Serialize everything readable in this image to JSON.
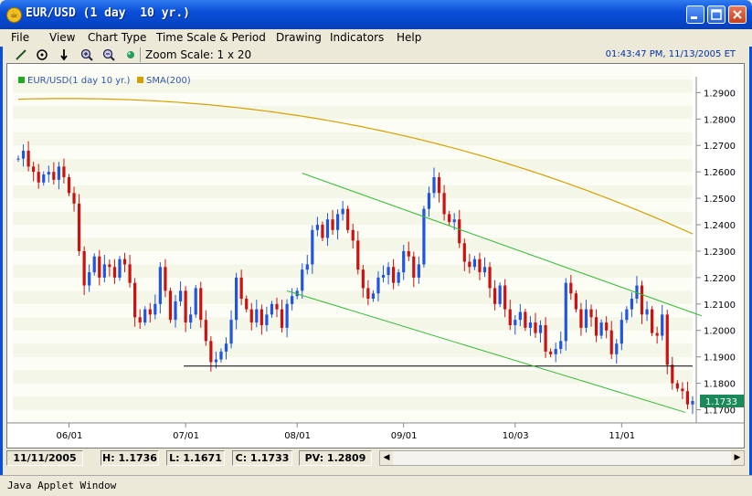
{
  "window": {
    "title": "EUR/USD (1 day  10 yr.)",
    "icon": "java-coffee-icon"
  },
  "menu": [
    "File",
    "View",
    "Chart Type",
    "Time Scale & Period",
    "Drawing",
    "Indicators",
    "Help"
  ],
  "toolbar": {
    "tools": [
      "line-draw-icon",
      "crosshair-icon",
      "arrow-down-icon",
      "zoom-in-icon",
      "zoom-out-icon",
      "color-dot-icon"
    ],
    "zoom_label": "Zoom Scale: 1 x 20",
    "datetime": "01:43:47 PM, 11/13/2005 ET"
  },
  "legend": [
    {
      "label": "EUR/USD(1 day  10 yr.)",
      "color": "#22aa22"
    },
    {
      "label": "SMA(200)",
      "color": "#d4a000"
    }
  ],
  "chart_data": {
    "type": "candlestick",
    "y_ticks": [
      "1.2900",
      "1.2800",
      "1.2700",
      "1.2600",
      "1.2500",
      "1.2400",
      "1.2300",
      "1.2200",
      "1.2100",
      "1.2000",
      "1.1900",
      "1.1800",
      "1.1700"
    ],
    "ylim": [
      1.165,
      1.296
    ],
    "x_ticks": [
      "06/01",
      "07/01",
      "08/01",
      "09/01",
      "10/03",
      "11/01"
    ],
    "last_price_label": "1.1733",
    "colors": {
      "up": "#2255dd",
      "down": "#cc1111",
      "sma": "#d4a000",
      "channel": "#33bb33",
      "support": "#000000",
      "last_price": "#1a8a5a"
    },
    "close": [
      1.265,
      1.268,
      1.262,
      1.26,
      1.256,
      1.259,
      1.26,
      1.257,
      1.262,
      1.258,
      1.252,
      1.248,
      1.23,
      1.217,
      1.222,
      1.228,
      1.22,
      1.225,
      1.224,
      1.22,
      1.227,
      1.225,
      1.218,
      1.205,
      1.203,
      1.208,
      1.206,
      1.21,
      1.224,
      1.215,
      1.204,
      1.211,
      1.215,
      1.203,
      1.206,
      1.216,
      1.204,
      1.196,
      1.188,
      1.189,
      1.192,
      1.195,
      1.204,
      1.22,
      1.212,
      1.208,
      1.203,
      1.208,
      1.202,
      1.206,
      1.21,
      1.208,
      1.201,
      1.21,
      1.213,
      1.215,
      1.223,
      1.225,
      1.238,
      1.24,
      1.235,
      1.242,
      1.238,
      1.244,
      1.246,
      1.238,
      1.234,
      1.223,
      1.216,
      1.212,
      1.214,
      1.22,
      1.221,
      1.224,
      1.218,
      1.222,
      1.23,
      1.228,
      1.22,
      1.225,
      1.246,
      1.252,
      1.258,
      1.252,
      1.244,
      1.241,
      1.242,
      1.233,
      1.226,
      1.224,
      1.227,
      1.222,
      1.224,
      1.216,
      1.21,
      1.217,
      1.208,
      1.202,
      1.204,
      1.207,
      1.201,
      1.203,
      1.199,
      1.202,
      1.192,
      1.191,
      1.193,
      1.196,
      1.218,
      1.214,
      1.208,
      1.201,
      1.208,
      1.205,
      1.198,
      1.203,
      1.2,
      1.191,
      1.195,
      1.204,
      1.208,
      1.212,
      1.217,
      1.206,
      1.208,
      1.199,
      1.198,
      1.206,
      1.187,
      1.18,
      1.178,
      1.177,
      1.172,
      1.1733
    ]
  },
  "statusbar": {
    "date": "11/11/2005",
    "high": "H: 1.1736",
    "low": "L: 1.1671",
    "close": "C: 1.1733",
    "pv": "PV: 1.2809"
  },
  "footer": {
    "text": "Java Applet Window"
  }
}
